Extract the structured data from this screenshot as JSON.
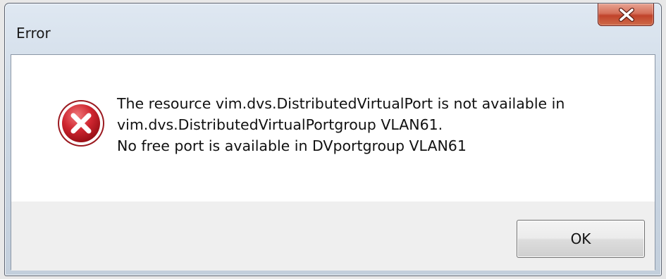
{
  "window": {
    "title": "Error"
  },
  "icons": {
    "close": "close-icon",
    "error": "error-icon"
  },
  "message": {
    "lines": [
      "The resource vim.dvs.DistributedVirtualPort is not available in",
      "vim.dvs.DistributedVirtualPortgroup VLAN61.",
      "No free port is available in DVportgroup VLAN61"
    ]
  },
  "buttons": {
    "ok_label": "OK"
  },
  "colors": {
    "close_button": "#c9452e",
    "error_icon": "#c8202a",
    "title_bar": "#cbd7e4"
  }
}
